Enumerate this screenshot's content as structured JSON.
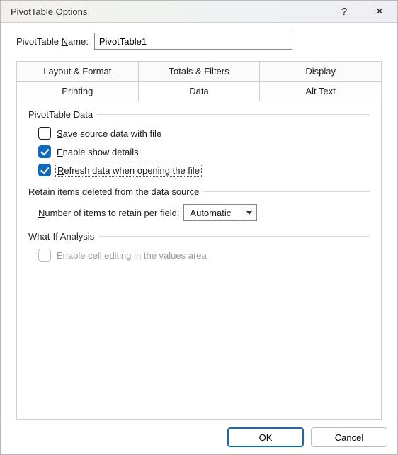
{
  "window": {
    "title": "PivotTable Options",
    "help_icon": "?",
    "close_icon": "✕"
  },
  "name_row": {
    "label_pre": "PivotTable ",
    "label_u": "N",
    "label_post": "ame:",
    "value": "PivotTable1"
  },
  "tabs": {
    "row1": [
      "Layout & Format",
      "Totals & Filters",
      "Display"
    ],
    "row2": [
      "Printing",
      "Data",
      "Alt Text"
    ],
    "active": "Data"
  },
  "section1": {
    "legend": "PivotTable Data",
    "opts": [
      {
        "u": "S",
        "post": "ave source data with file",
        "checked": false
      },
      {
        "u": "E",
        "post": "nable show details",
        "checked": true
      },
      {
        "u": "R",
        "post": "efresh data when opening the file",
        "checked": true,
        "focused": true
      }
    ]
  },
  "section2": {
    "legend": "Retain items deleted from the data source",
    "label_u": "N",
    "label_post": "umber of items to retain per field:",
    "value": "Automatic"
  },
  "section3": {
    "legend": "What-If Analysis",
    "opt": {
      "label": "Enable cell editing in the values area",
      "disabled": true
    }
  },
  "buttons": {
    "ok": "OK",
    "cancel": "Cancel"
  }
}
